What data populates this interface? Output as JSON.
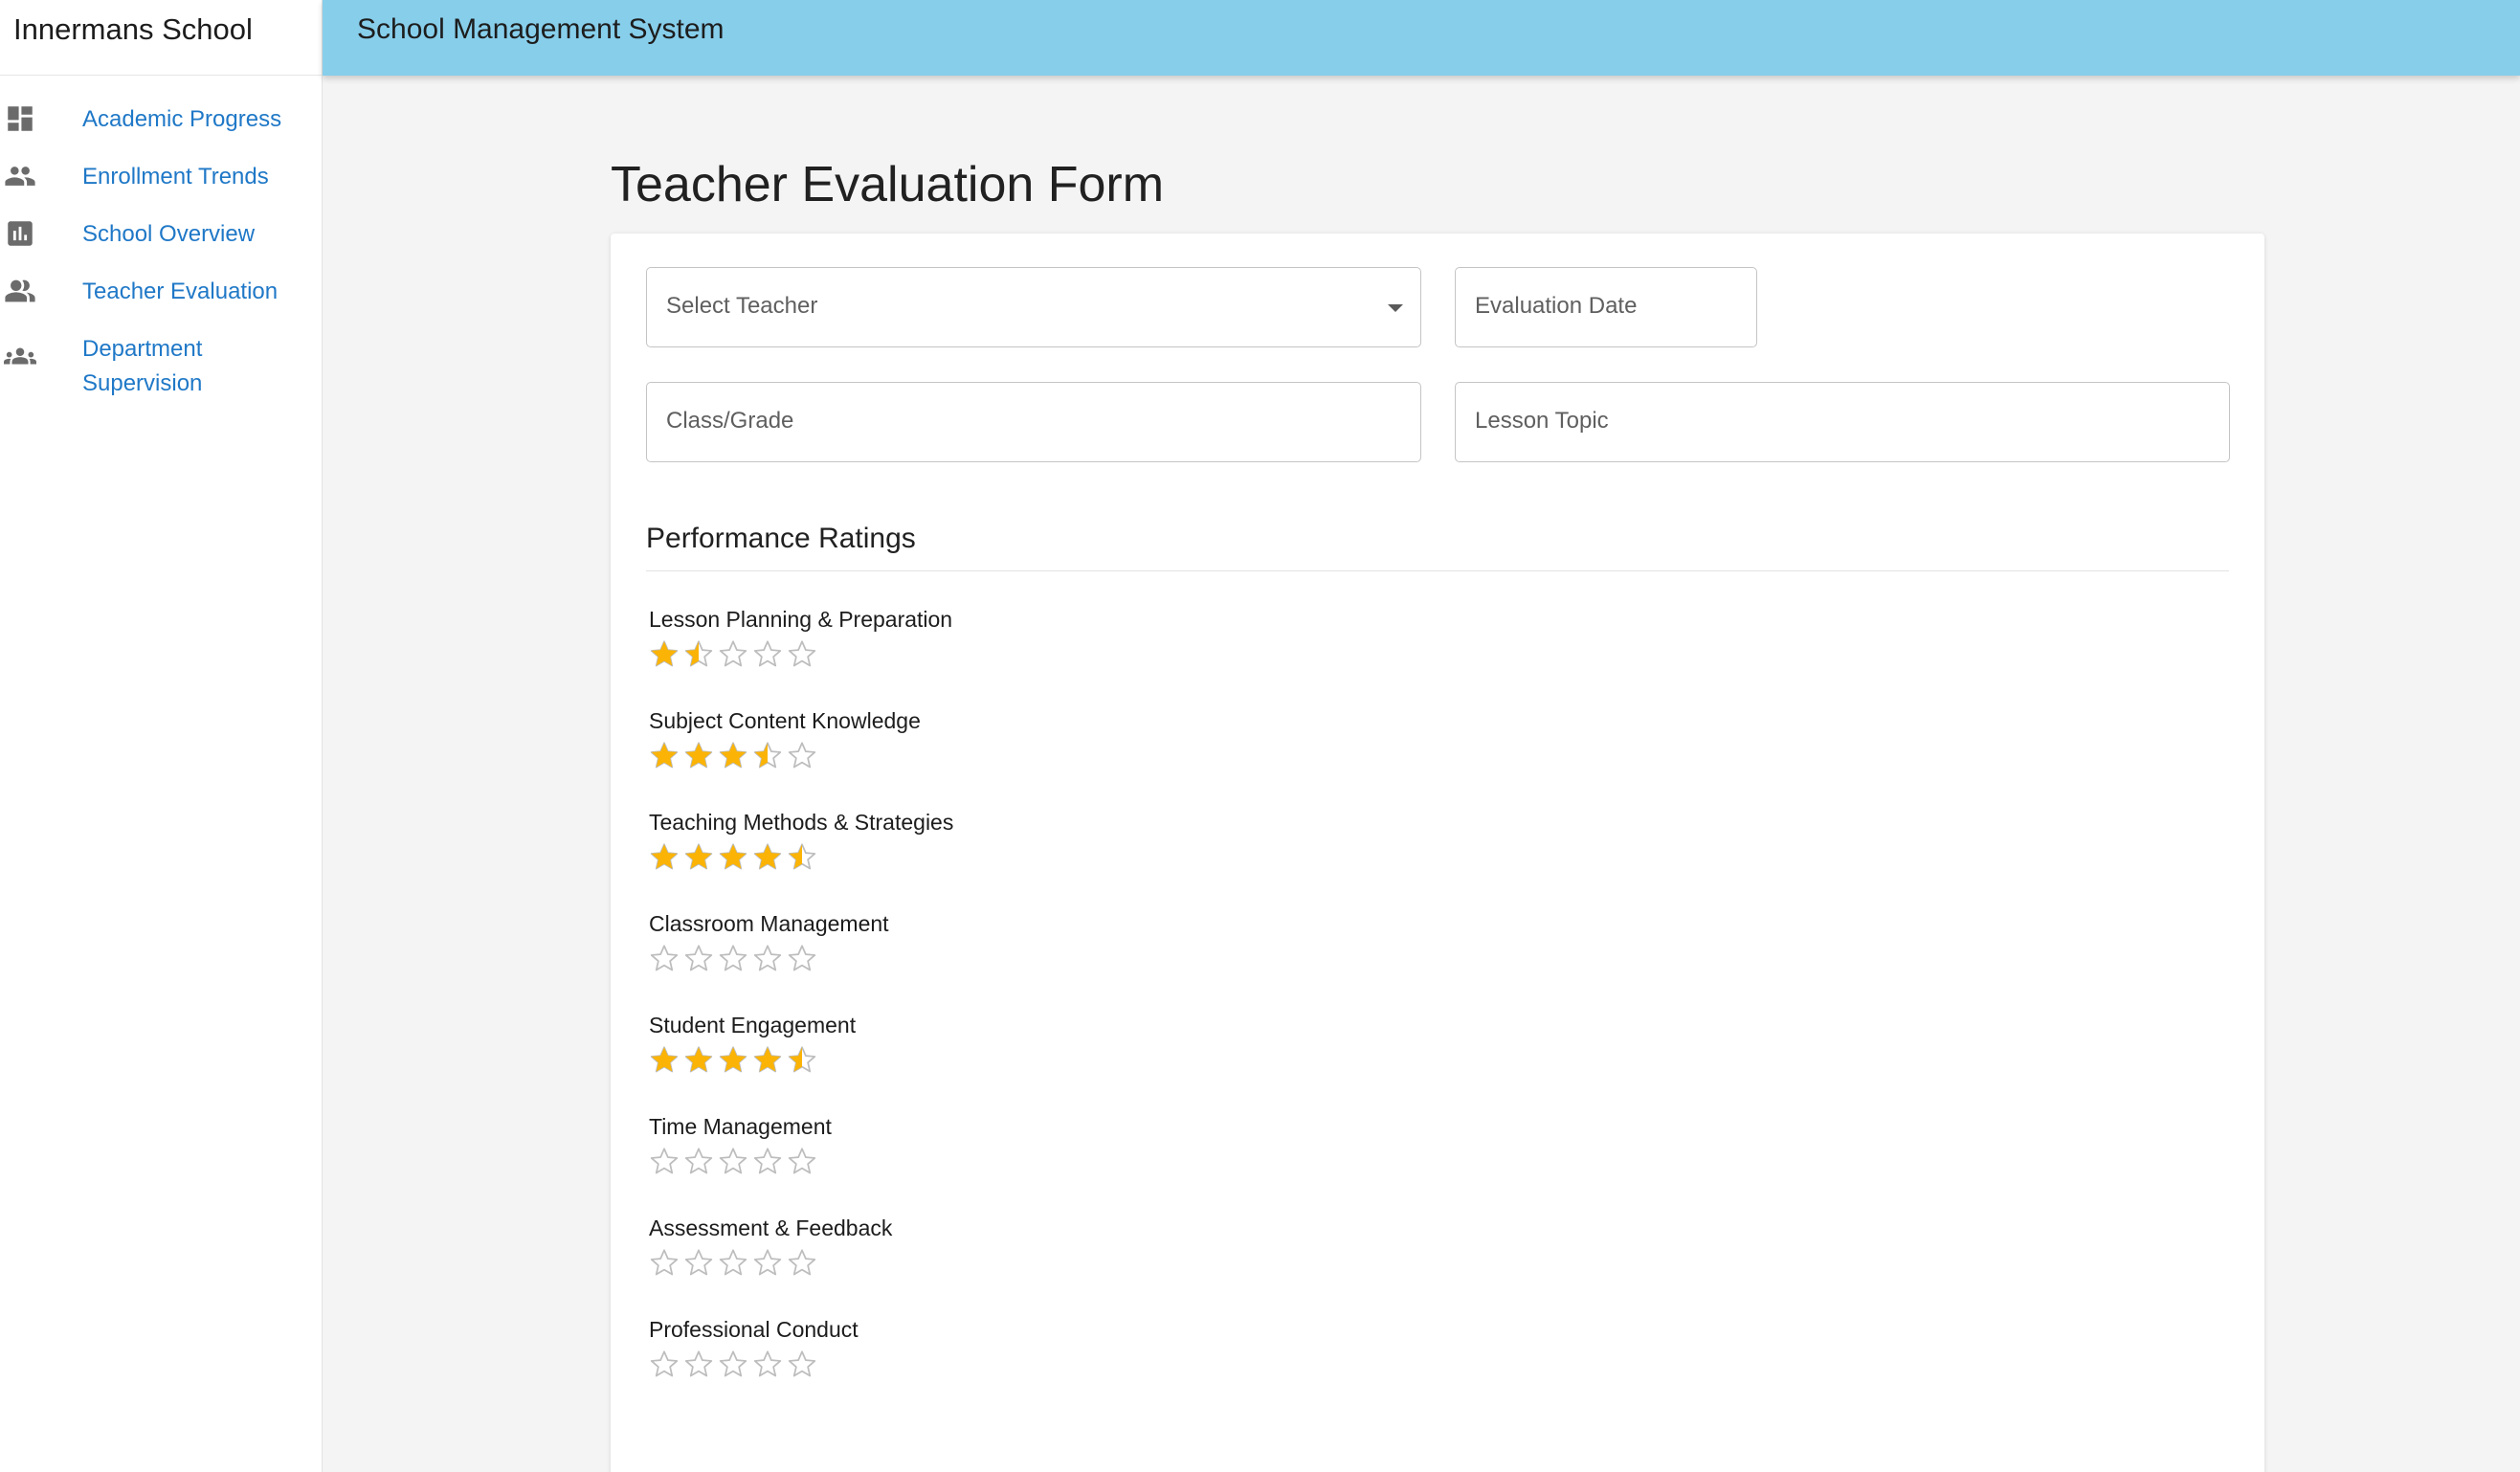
{
  "sidebar": {
    "brand": "Innermans School",
    "items": [
      {
        "label": "Academic Progress",
        "icon": "dashboard-icon"
      },
      {
        "label": "Enrollment Trends",
        "icon": "people-icon"
      },
      {
        "label": "School Overview",
        "icon": "bar-chart-icon"
      },
      {
        "label": "Teacher Evaluation",
        "icon": "people-alt-icon"
      },
      {
        "label": "Department Supervision",
        "icon": "groups-icon"
      }
    ]
  },
  "header": {
    "title": "School Management System"
  },
  "main": {
    "title": "Teacher Evaluation Form",
    "fields": {
      "teacher": {
        "placeholder": "Select Teacher",
        "value": ""
      },
      "date": {
        "placeholder": "Evaluation Date",
        "value": ""
      },
      "class": {
        "placeholder": "Class/Grade",
        "value": ""
      },
      "topic": {
        "placeholder": "Lesson Topic",
        "value": ""
      }
    },
    "ratings_title": "Performance Ratings",
    "ratings": [
      {
        "label": "Lesson Planning & Preparation",
        "value": 1.5,
        "max": 5
      },
      {
        "label": "Subject Content Knowledge",
        "value": 3.5,
        "max": 5
      },
      {
        "label": "Teaching Methods & Strategies",
        "value": 4.5,
        "max": 5
      },
      {
        "label": "Classroom Management",
        "value": 0,
        "max": 5
      },
      {
        "label": "Student Engagement",
        "value": 4.5,
        "max": 5
      },
      {
        "label": "Time Management",
        "value": 0,
        "max": 5
      },
      {
        "label": "Assessment & Feedback",
        "value": 0,
        "max": 5
      },
      {
        "label": "Professional Conduct",
        "value": 0,
        "max": 5
      }
    ]
  },
  "colors": {
    "header_bg": "#87ceeb",
    "link": "#1f78c7",
    "star_filled": "#fbb406",
    "star_empty": "#bdbdbd"
  }
}
